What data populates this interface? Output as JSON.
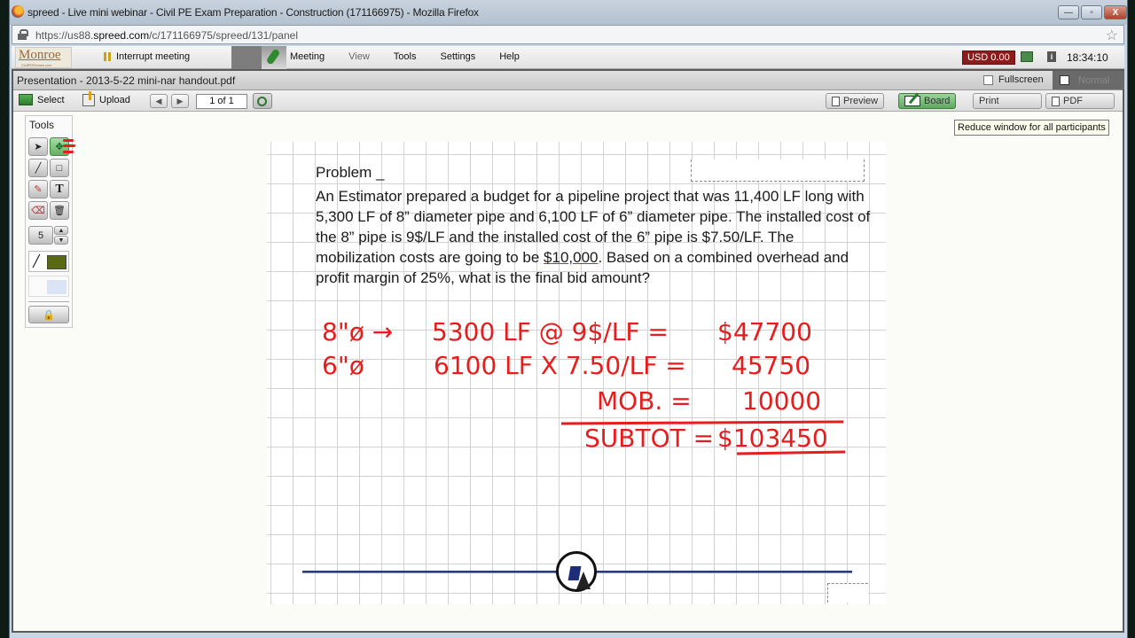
{
  "browser": {
    "title": "spreed - Live mini webinar - Civil PE Exam Preparation - Construction (171166975) - Mozilla Firefox",
    "url_prefix": "https://us88.",
    "url_domain": "spreed.com",
    "url_path": "/c/171166975/spreed/131/panel",
    "minimize": "—",
    "maximize": "▫",
    "close": "X"
  },
  "app": {
    "logo": "Monroe",
    "logo_sub": "CivilPEReview.com",
    "interrupt_label": "Interrupt meeting",
    "menu": [
      "Meeting",
      "View",
      "Tools",
      "Settings",
      "Help"
    ],
    "balance": "USD 0.00",
    "info": "i",
    "clock": "18:34:10"
  },
  "presentation": {
    "title": "Presentation - 2013-5-22 mini-nar handout.pdf",
    "fullscreen_label": "Fullscreen",
    "normal_label": "Normal",
    "select_label": "Select",
    "upload_label": "Upload",
    "prev": "◀",
    "next": "▶",
    "page": "1 of 1",
    "preview_label": "Preview",
    "board_label": "Board",
    "print_label": "Print",
    "pdf_label": "PDF",
    "tooltip": "Reduce window for all participants"
  },
  "tools": {
    "label": "Tools",
    "pointer": "➤",
    "move": "✥",
    "line": "╱",
    "rect": "□",
    "pencil": "✎",
    "text": "T",
    "eraser": "⌫",
    "trash": "🗑",
    "stroke_width": "5",
    "up": "▲",
    "down": "▼",
    "line_color": "#5a6a14",
    "fill_color": "#dbe4f5",
    "lock": "🔒"
  },
  "document": {
    "problem_heading": "Problem _",
    "problem_text_1": "An Estimator prepared a budget for a pipeline project that was 11,400 LF long with 5,300 LF of 8” diameter pipe and 6,100 LF of 6” diameter pipe.  The installed cost of the 8” pipe is 9$/LF and the installed cost of the 6” pipe is $7.50/LF.  The mobilization costs are going to be ",
    "problem_amount": "$10,000",
    "problem_text_2": ".  Based on a combined overhead and profit margin of 25%, what is the final bid amount?"
  },
  "handwriting": {
    "line1_label": "8\"ø →",
    "line1_calc": "5300 LF @ 9$/LF =",
    "line1_result": "$47700",
    "line2_label": "6\"ø",
    "line2_calc": "6100 LF X 7.50/LF =",
    "line2_result": "45750",
    "line3_label": "MOB. =",
    "line3_result": "10000",
    "line4_label": "SUBTOT =",
    "line4_result": "$103450",
    "ink_color": "#e81c1c"
  }
}
